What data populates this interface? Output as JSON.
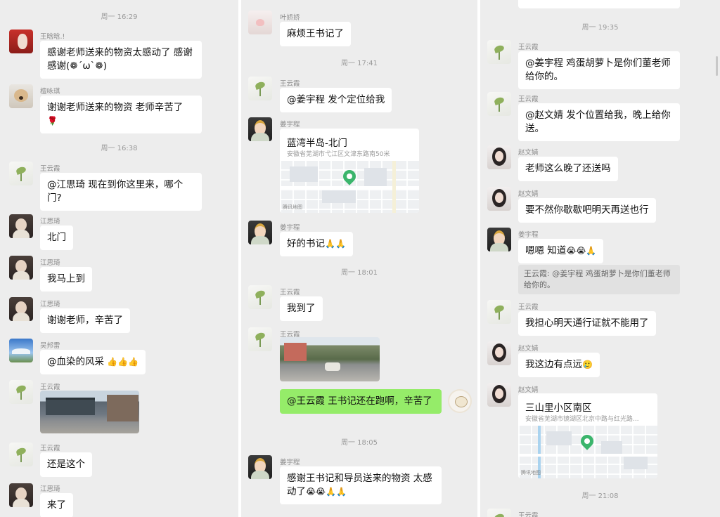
{
  "panel1": {
    "time1": "周一 16:29",
    "time2": "周一 16:38",
    "m1": {
      "sender": "王晗晗.!",
      "text": "感谢老师送来的物资太感动了 感谢感谢(❁´ω`❁)"
    },
    "m2": {
      "sender": "檀咏琪",
      "text": "谢谢老师送来的物资  老师辛苦了",
      "emoji": "🌹"
    },
    "m3": {
      "sender": "王云霞",
      "text": "@江思琦  现在到你这里来，哪个门?"
    },
    "m4": {
      "sender": "江思琦",
      "text": "北门"
    },
    "m5": {
      "sender": "江思琦",
      "text": "我马上到"
    },
    "m6": {
      "sender": "江思琦",
      "text": "谢谢老师，辛苦了"
    },
    "m7": {
      "sender": "吴邦雷",
      "text": "@血染的风采 ",
      "emoji": "👍👍👍"
    },
    "m8": {
      "sender": "王云霞"
    },
    "m9": {
      "sender": "王云霞",
      "text": "还是这个"
    },
    "m10": {
      "sender": "江思琦",
      "text": "来了"
    }
  },
  "panel2": {
    "time1": "周一 17:41",
    "time2": "周一 18:01",
    "time3": "周一 18:05",
    "m1": {
      "sender": "叶娇娇",
      "text": "麻烦王书记了"
    },
    "m2": {
      "sender": "王云霞",
      "text": "@姜宇程  发个定位给我"
    },
    "m3": {
      "sender": "姜宇程",
      "title": "蓝湾半岛-北门",
      "address": "安徽省芜湖市弋江区文津东路南50米",
      "credit": "腾讯地图"
    },
    "m4": {
      "sender": "姜宇程",
      "text": "好的书记",
      "emoji": "🙏🙏"
    },
    "m5": {
      "sender": "王云霞",
      "text": "我到了"
    },
    "m6": {
      "sender": "王云霞"
    },
    "m7": {
      "text": "@王云霞  王书记还在跑啊，辛苦了"
    },
    "m8": {
      "sender": "姜宇程",
      "text": "感谢王书记和导员送来的物资 太感动了",
      "emoji": "😭😭🙏🙏"
    }
  },
  "panel3": {
    "time1": "周一 19:35",
    "time2": "周一 21:08",
    "m1": {
      "sender": "王云霞",
      "text": "@姜宇程  鸡蛋胡萝卜是你们董老师给你的。"
    },
    "m2": {
      "sender": "王云霞",
      "text": "@赵文婧  发个位置给我，晚上给你送。"
    },
    "m3": {
      "sender": "赵文婧",
      "text": "老师这么晚了还送吗"
    },
    "m4": {
      "sender": "赵文婧",
      "text": "要不然你歇歇吧明天再送也行"
    },
    "m5": {
      "sender": "姜宇程",
      "text": "嗯嗯 知道",
      "emoji": "😭😭🙏"
    },
    "quote": "王云霞: @姜宇程 鸡蛋胡萝卜是你们董老师给你的。",
    "m6": {
      "sender": "王云霞",
      "text": "我担心明天通行证就不能用了"
    },
    "m7": {
      "sender": "赵文婧",
      "text": "我这边有点远",
      "emoji": "🥲"
    },
    "m8": {
      "sender": "赵文婧",
      "title": "三山里小区南区",
      "address": "安徽省芜湖市镜湖区北京中路与红光路...",
      "credit": "腾讯地图"
    },
    "m9": {
      "sender": "王云霞"
    }
  }
}
